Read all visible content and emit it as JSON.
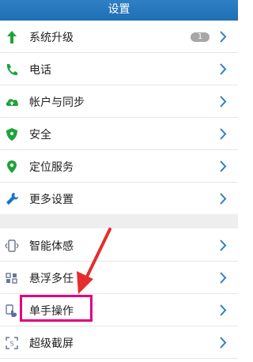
{
  "header": {
    "title": "设置"
  },
  "badge": {
    "count": "1"
  },
  "group1": [
    {
      "label": "系统升级",
      "icon": "arrow-up-icon",
      "color": "#1ea33b"
    },
    {
      "label": "电话",
      "icon": "phone-icon",
      "color": "#1ea33b"
    },
    {
      "label": "帐户与同步",
      "icon": "cloud-sync-icon",
      "color": "#1ea33b"
    },
    {
      "label": "安全",
      "icon": "shield-icon",
      "color": "#1ea33b"
    },
    {
      "label": "定位服务",
      "icon": "location-pin-icon",
      "color": "#1ea33b"
    },
    {
      "label": "更多设置",
      "icon": "wrench-icon",
      "color": "#1a73c9"
    }
  ],
  "group2": [
    {
      "label": "智能体感",
      "icon": "phone-motion-icon",
      "color": "#6a7a96"
    },
    {
      "label": "悬浮多任",
      "icon": "floating-window-icon",
      "color": "#6a7a96"
    },
    {
      "label": "单手操作",
      "icon": "one-hand-icon",
      "color": "#5b6aa8"
    },
    {
      "label": "超级截屏",
      "icon": "screenshot-icon",
      "color": "#6a7a96"
    }
  ],
  "colors": {
    "header": "#1e6fb6",
    "chevron": "#2f7fc4",
    "highlight_box": "#e0007e",
    "annotation_arrow": "#e52d2d"
  }
}
